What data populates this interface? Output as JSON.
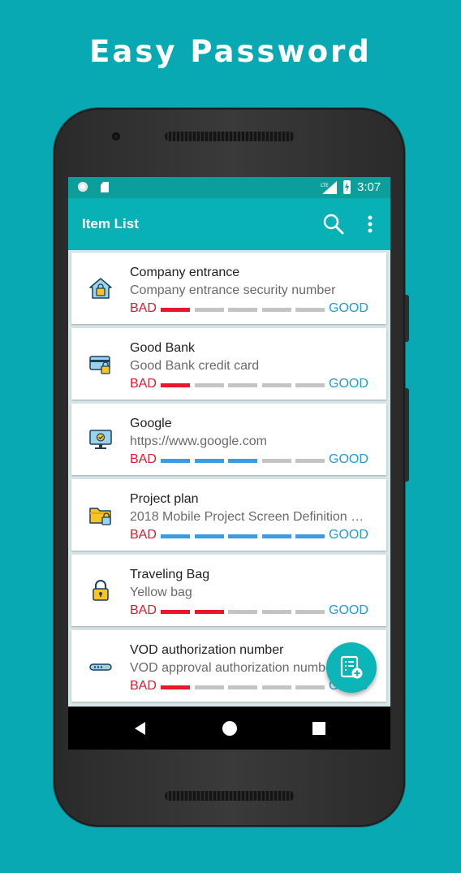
{
  "headline": "Easy Password",
  "status_bar": {
    "time": "3:07",
    "network": "LTE"
  },
  "app_bar": {
    "title": "Item List",
    "icons": [
      "search-icon",
      "more-vert-icon"
    ]
  },
  "strength_labels": {
    "bad": "BAD",
    "good": "GOOD"
  },
  "items": [
    {
      "title": "Company entrance",
      "subtitle": "Company entrance security number",
      "icon": "house-lock-icon",
      "strength": 1,
      "strength_color": "#e8172a",
      "bad": "BAD",
      "good": "GOOD"
    },
    {
      "title": "Good Bank",
      "subtitle": "Good Bank credit card",
      "icon": "credit-card-lock-icon",
      "strength": 1,
      "strength_color": "#e8172a",
      "bad": "BAD",
      "good": "GOOD"
    },
    {
      "title": "Google",
      "subtitle": "https://www.google.com",
      "icon": "monitor-check-icon",
      "strength": 3,
      "strength_color": "#3a9ce2",
      "bad": "BAD",
      "good": "GOOD"
    },
    {
      "title": "Project plan",
      "subtitle": "2018 Mobile Project Screen Definition …",
      "icon": "folder-lock-icon",
      "strength": 5,
      "strength_color": "#3a9ce2",
      "bad": "BAD",
      "good": "GOOD"
    },
    {
      "title": "Traveling Bag",
      "subtitle": "Yellow bag",
      "icon": "padlock-icon",
      "strength": 2,
      "strength_color": "#e8172a",
      "bad": "BAD",
      "good": "GOOD"
    },
    {
      "title": "VOD authorization number",
      "subtitle": "VOD approval authorization number",
      "icon": "router-icon",
      "strength": 1,
      "strength_color": "#e8172a",
      "bad": "BAD",
      "good": "GOOD"
    }
  ],
  "fab": {
    "icon": "add-note-icon"
  },
  "nav_bar": {
    "icons": [
      "back-icon",
      "home-icon",
      "recents-icon"
    ]
  },
  "colors": {
    "background": "#08a9b3",
    "app_bar": "#08b1b6",
    "status_bar": "#0c9e9b",
    "bad": "#e8172a",
    "good": "#1f9bd6",
    "strong_meter": "#3a9ce2",
    "empty_meter": "#c4c4c4"
  }
}
